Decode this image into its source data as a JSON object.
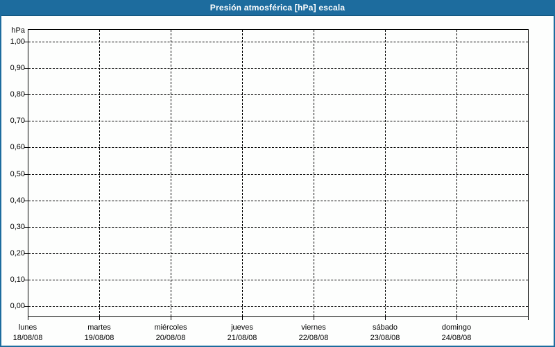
{
  "header": {
    "title": "Presión atmosférica [hPa] escala"
  },
  "colors": {
    "header_bg": "#1d6c9e",
    "page_border": "#1d6c9e",
    "title_text": "#ffffff",
    "grid": "#000000",
    "axis_text": "#000000",
    "plot_bg": "#fdfefd"
  },
  "chart_data": {
    "type": "line",
    "title": "Presión atmosférica [hPa] escala",
    "xlabel": "",
    "ylabel": "hPa",
    "ylim": [
      0.0,
      1.0
    ],
    "ytick_step": 0.1,
    "y_ticks_top_to_bottom": [
      "1,00",
      "0,90",
      "0,80",
      "0,70",
      "0,60",
      "0,50",
      "0,40",
      "0,30",
      "0,20",
      "0,10",
      "0,00"
    ],
    "x_categories": [
      {
        "day": "lunes",
        "date": "18/08/08"
      },
      {
        "day": "martes",
        "date": "19/08/08"
      },
      {
        "day": "miércoles",
        "date": "20/08/08"
      },
      {
        "day": "jueves",
        "date": "21/08/08"
      },
      {
        "day": "viernes",
        "date": "22/08/08"
      },
      {
        "day": "sábado",
        "date": "23/08/08"
      },
      {
        "day": "domingo",
        "date": "24/08/08"
      }
    ],
    "series": [],
    "grid": "dashed",
    "legend_position": "none"
  }
}
